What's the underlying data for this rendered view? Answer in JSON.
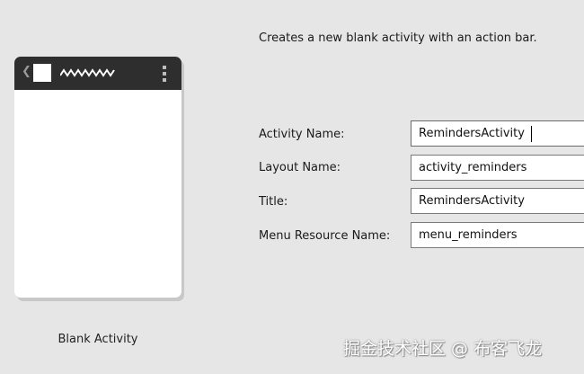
{
  "template": {
    "name": "Blank Activity",
    "description": "Creates a new blank activity with an action bar."
  },
  "form": {
    "fields": [
      {
        "label": "Activity Name:",
        "value": "RemindersActivity"
      },
      {
        "label": "Layout Name:",
        "value": "activity_reminders"
      },
      {
        "label": "Title:",
        "value": "RemindersActivity"
      },
      {
        "label": "Menu Resource Name:",
        "value": "menu_reminders"
      }
    ]
  },
  "preview": {
    "icons": [
      "back-chevron-icon",
      "app-icon",
      "title-placeholder-icon",
      "overflow-menu-icon"
    ],
    "action_bar_color": "#2f2e2e"
  },
  "watermark": "掘金技术社区 @ 布客飞龙"
}
